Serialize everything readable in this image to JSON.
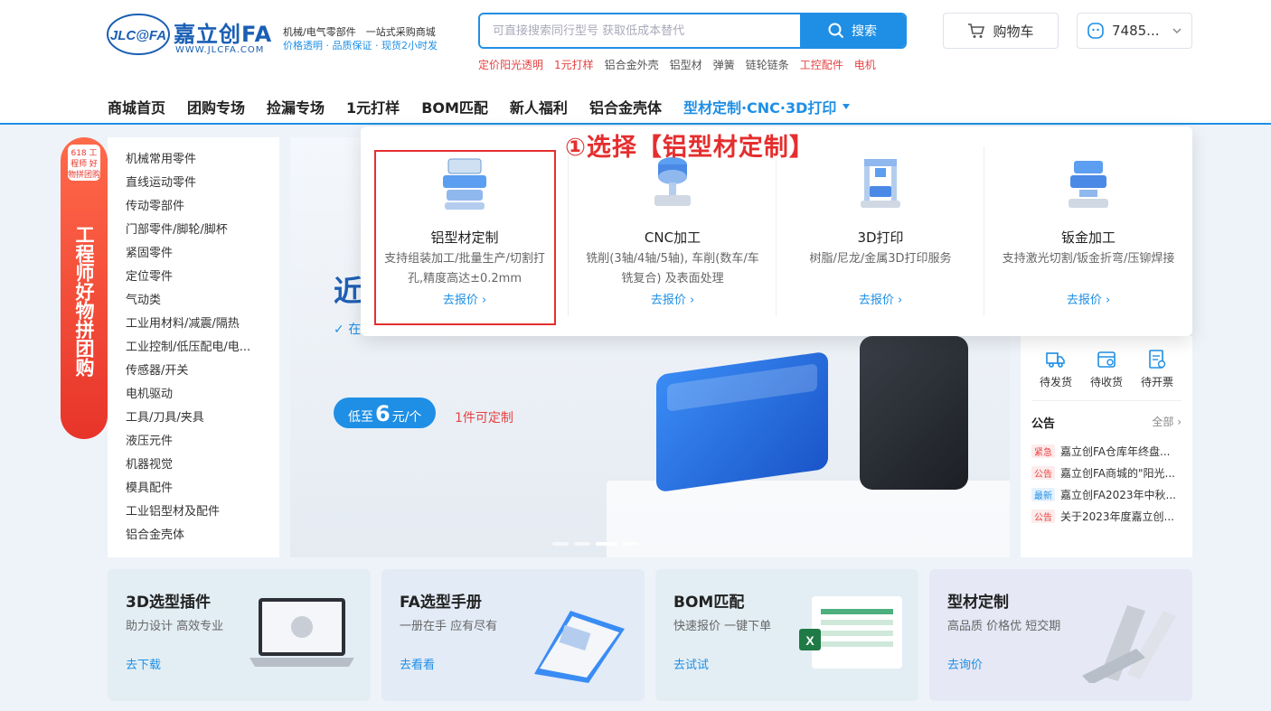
{
  "header": {
    "logo_text": "JLC@FA",
    "brand_name": "嘉立创FA",
    "url": "WWW.JLCFA.COM",
    "tagline_1": "机械/电气零部件　一站式采购商城",
    "tagline_2": "价格透明 · 品质保证 · 现货2小时发",
    "search": {
      "placeholder": "可直接搜索同行型号 获取低成本替代",
      "button": "搜索"
    },
    "hot_keywords": [
      {
        "text": "定价阳光透明",
        "red": true
      },
      {
        "text": "1元打样",
        "red": true
      },
      {
        "text": "铝合金外壳",
        "red": false
      },
      {
        "text": "铝型材",
        "red": false
      },
      {
        "text": "弹簧",
        "red": false
      },
      {
        "text": "链轮链条",
        "red": false
      },
      {
        "text": "工控配件",
        "red": true
      },
      {
        "text": "电机",
        "red": true
      }
    ],
    "cart_label": "购物车",
    "user_label": "7485..."
  },
  "nav": {
    "items": [
      "商城首页",
      "团购专场",
      "捡漏专场",
      "1元打样",
      "BOM匹配",
      "新人福利",
      "铝合金壳体"
    ],
    "active": "型材定制·CNC·3D打印"
  },
  "category_banner": {
    "badge": "618 工程师 好物拼团购",
    "vertical_text": "工程师好物拼团购"
  },
  "categories": [
    "机械常用零件",
    "直线运动零件",
    "传动零部件",
    "门部零件/脚轮/脚杯",
    "紧固零件",
    "定位零件",
    "气动类",
    "工业用材料/减震/隔热",
    "工业控制/低压配电/电...",
    "传感器/开关",
    "电机驱动",
    "工具/刀具/夹具",
    "液压元件",
    "机器视觉",
    "模具配件",
    "工业铝型材及配件",
    "铝合金壳体"
  ],
  "hero": {
    "headline": "近",
    "check_text": "在",
    "price_prefix": "低至",
    "price_value": "6",
    "price_suffix": "元/个",
    "price_note": "1件可定制"
  },
  "right_panel": {
    "orders": [
      "待发货",
      "待收货",
      "待开票"
    ],
    "notice_title": "公告",
    "notice_all": "全部",
    "notices": [
      {
        "tag": "紧急",
        "color": "red",
        "text": "嘉立创FA仓库年终盘..."
      },
      {
        "tag": "公告",
        "color": "red",
        "text": "嘉立创FA商城的\"阳光..."
      },
      {
        "tag": "最新",
        "color": "blue",
        "text": "嘉立创FA2023年中秋..."
      },
      {
        "tag": "公告",
        "color": "red",
        "text": "关于2023年度嘉立创..."
      }
    ]
  },
  "dropdown": {
    "items": [
      {
        "title": "铝型材定制",
        "desc": "支持组装加工/批量生产/切割打孔,精度高达±0.2mm",
        "link": "去报价"
      },
      {
        "title": "CNC加工",
        "desc": "铣削(3轴/4轴/5轴), 车削(数车/车铣复合) 及表面处理",
        "link": "去报价"
      },
      {
        "title": "3D打印",
        "desc": "树脂/尼龙/金属3D打印服务",
        "link": "去报价"
      },
      {
        "title": "钣金加工",
        "desc": "支持激光切割/钣金折弯/压铆焊接",
        "link": "去报价"
      }
    ],
    "annotation": "①选择【铝型材定制】"
  },
  "cards": [
    {
      "title": "3D选型插件",
      "subtitle": "助力设计 高效专业",
      "link": "去下载",
      "bg": "#e3eef4"
    },
    {
      "title": "FA选型手册",
      "subtitle": "一册在手 应有尽有",
      "link": "去看看",
      "bg": "#e3ebf6"
    },
    {
      "title": "BOM匹配",
      "subtitle": "快速报价 一键下单",
      "link": "去试试",
      "bg": "#e3eef4"
    },
    {
      "title": "型材定制",
      "subtitle": "高品质 价格优 短交期",
      "link": "去询价",
      "bg": "#e6e8f6"
    }
  ],
  "colors": {
    "accent": "#1f8fe5",
    "annotation": "#e52e2e",
    "hot_red": "#e54343"
  }
}
